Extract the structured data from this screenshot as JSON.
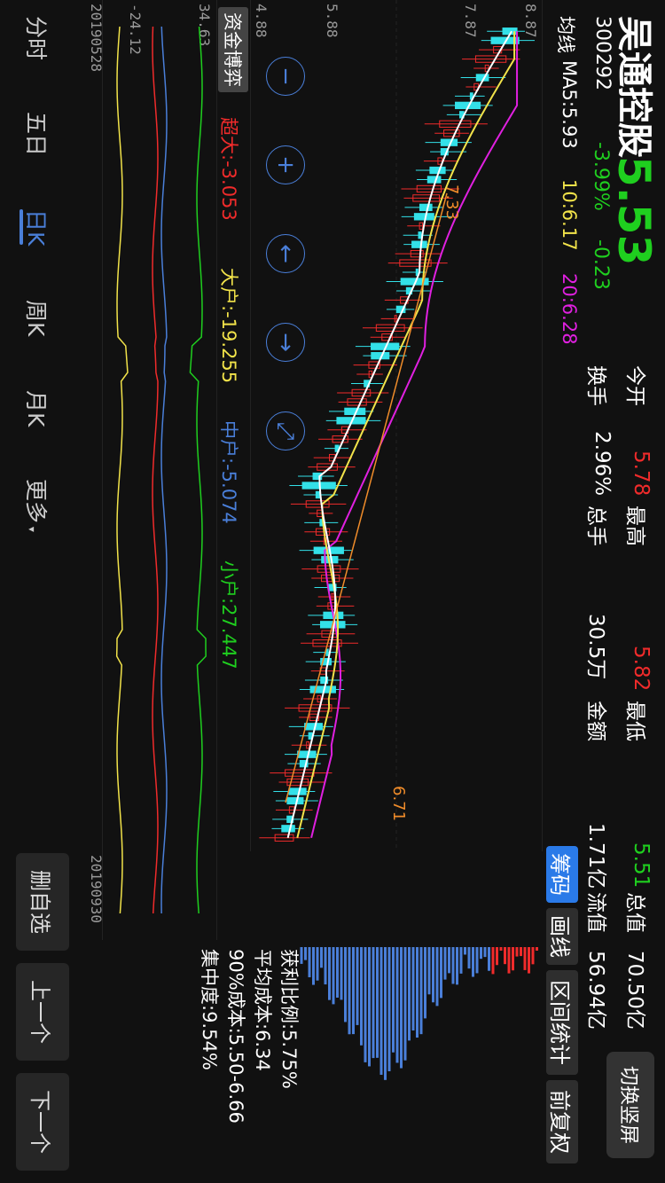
{
  "stock": {
    "name": "吴通控股",
    "code": "300292",
    "price": "5.53",
    "change_pct": "-3.99%",
    "change_amt": "-0.23"
  },
  "quote": {
    "open_label": "今开",
    "open_value": "5.78",
    "high_label": "最高",
    "high_value": "5.82",
    "low_label": "最低",
    "low_value": "5.51",
    "mcap_label": "总值",
    "mcap_value": "70.50亿",
    "turnover_label": "换手",
    "turnover_value": "2.96%",
    "volume_label": "总手",
    "volume_value": "30.5万",
    "amount_label": "金额",
    "amount_value": "1.71亿",
    "float_label": "流值",
    "float_value": "56.94亿"
  },
  "switch_button": "切换竖屏",
  "ma": {
    "label": "均线",
    "ma5": "MA5:5.93",
    "ma10": "10:6.17",
    "ma20": "20:6.28"
  },
  "side_tabs": [
    "筹码",
    "画线",
    "区间统计",
    "前复权"
  ],
  "chips": {
    "profit_ratio": "获利比例:5.75%",
    "avg_cost": "平均成本:6.34",
    "cost90": "90%成本:5.50-6.66",
    "concentration": "集中度:9.54%"
  },
  "flow": {
    "title": "资金博弈",
    "super": "超大:-3.053",
    "big": "大户:-19.255",
    "mid": "中户:-5.074",
    "small": "小户:27.447"
  },
  "period_tabs": [
    "分时",
    "五日",
    "日K",
    "周K",
    "月K",
    "更多"
  ],
  "active_period": 2,
  "side_actions": [
    "删自选",
    "上一个",
    "下一个"
  ],
  "dates": {
    "start": "20190528",
    "end": "20190930"
  },
  "colors": {
    "up": "#f02b2b",
    "down": "#33e0e8",
    "ma5": "#ffffff",
    "ma10": "#f2e34a",
    "ma20": "#e020e0",
    "accent": "#4a7fd9"
  },
  "chart_data": {
    "type": "candlestick",
    "y_axis_ticks": [
      "8.87",
      "7.87",
      "5.88",
      "4.88"
    ],
    "annotations": {
      "high_mark": "7.33",
      "low_mark": "6.71"
    },
    "flow_axis_ticks": [
      "34.63",
      "-24.12"
    ]
  }
}
